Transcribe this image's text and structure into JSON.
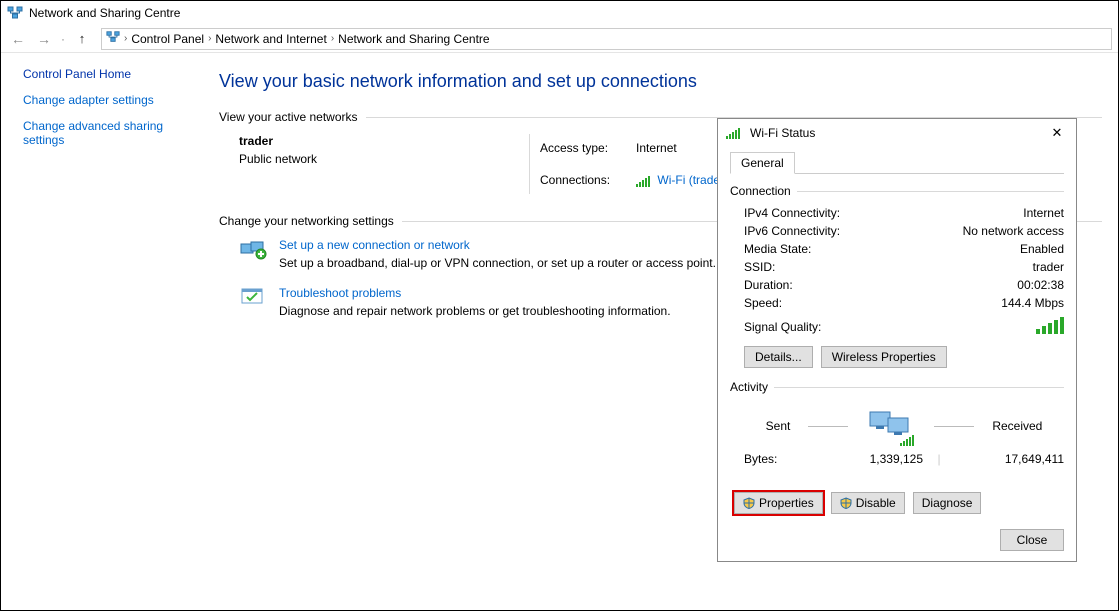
{
  "window": {
    "title": "Network and Sharing Centre"
  },
  "nav": {
    "crumbs": [
      "Control Panel",
      "Network and Internet",
      "Network and Sharing Centre"
    ]
  },
  "sidebar": {
    "home": "Control Panel Home",
    "link1": "Change adapter settings",
    "link2": "Change advanced sharing settings"
  },
  "main": {
    "title": "View your basic network information and set up connections",
    "active_group": "View your active networks",
    "settings_group": "Change your networking settings",
    "network": {
      "name": "trader",
      "type": "Public network",
      "access_label": "Access type:",
      "access_value": "Internet",
      "conn_label": "Connections:",
      "conn_value": "Wi-Fi (trader)"
    },
    "action1": {
      "label": "Set up a new connection or network",
      "desc": "Set up a broadband, dial-up or VPN connection, or set up a router or access point."
    },
    "action2": {
      "label": "Troubleshoot problems",
      "desc": "Diagnose and repair network problems or get troubleshooting information."
    }
  },
  "dialog": {
    "title": "Wi-Fi Status",
    "tab": "General",
    "conn_section": "Connection",
    "rows": {
      "ipv4": {
        "k": "IPv4 Connectivity:",
        "v": "Internet"
      },
      "ipv6": {
        "k": "IPv6 Connectivity:",
        "v": "No network access"
      },
      "media": {
        "k": "Media State:",
        "v": "Enabled"
      },
      "ssid": {
        "k": "SSID:",
        "v": "trader"
      },
      "duration": {
        "k": "Duration:",
        "v": "00:02:38"
      },
      "speed": {
        "k": "Speed:",
        "v": "144.4 Mbps"
      },
      "signal": {
        "k": "Signal Quality:"
      }
    },
    "details_btn": "Details...",
    "wprops_btn": "Wireless Properties",
    "activity_section": "Activity",
    "sent_label": "Sent",
    "recv_label": "Received",
    "bytes_label": "Bytes:",
    "bytes_sent": "1,339,125",
    "bytes_recv": "17,649,411",
    "props_btn": "Properties",
    "disable_btn": "Disable",
    "diagnose_btn": "Diagnose",
    "close_btn": "Close"
  }
}
